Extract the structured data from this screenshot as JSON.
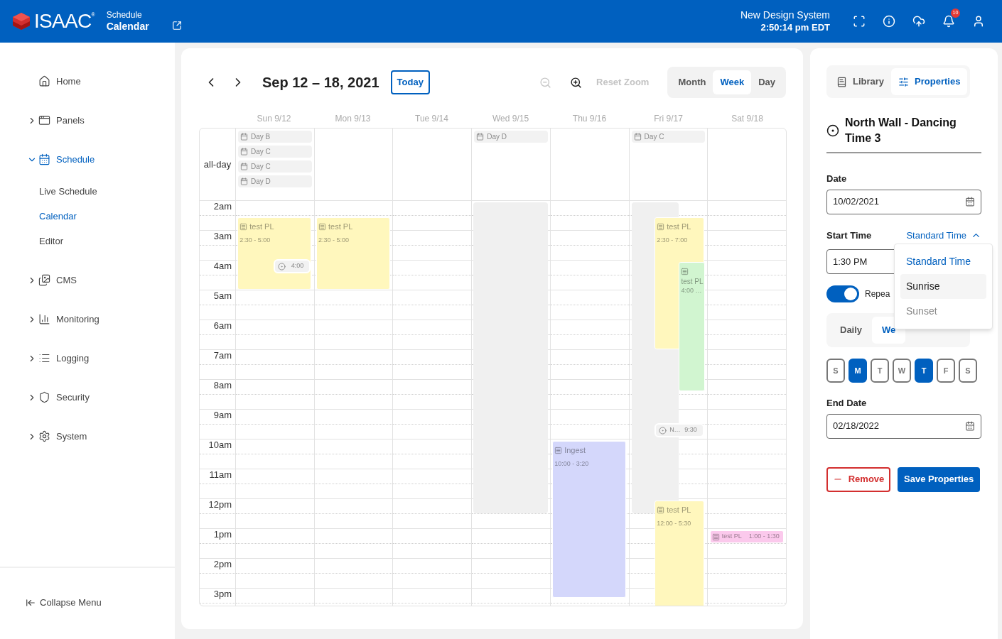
{
  "header": {
    "brand": "ISAAC",
    "brand_mark": "®",
    "section": "Schedule",
    "page": "Calendar",
    "system": "New Design System",
    "clock": "2:50:14 pm EDT",
    "notifications": "10"
  },
  "sidebar": {
    "items": [
      {
        "label": "Home",
        "selected": false
      },
      {
        "label": "Panels",
        "expanded": false,
        "selected": false
      },
      {
        "label": "Schedule",
        "expanded": true,
        "selected": true,
        "children": [
          {
            "label": "Live Schedule",
            "selected": false
          },
          {
            "label": "Calendar",
            "selected": true
          },
          {
            "label": "Editor",
            "selected": false
          }
        ]
      },
      {
        "label": "CMS",
        "expanded": false,
        "selected": false
      },
      {
        "label": "Monitoring",
        "expanded": false,
        "selected": false
      },
      {
        "label": "Logging",
        "expanded": false,
        "selected": false
      },
      {
        "label": "Security",
        "expanded": false,
        "selected": false
      },
      {
        "label": "System",
        "expanded": false,
        "selected": false
      }
    ],
    "collapse": "Collapse Menu"
  },
  "toolbar": {
    "range": "Sep 12 – 18, 2021",
    "today": "Today",
    "zoom_out_disabled": true,
    "reset_zoom": "Reset Zoom",
    "reset_disabled": true,
    "views": [
      {
        "label": "Month",
        "selected": false
      },
      {
        "label": "Week",
        "selected": true
      },
      {
        "label": "Day",
        "selected": false
      }
    ]
  },
  "calendar": {
    "all_day_label": "all-day",
    "hours": [
      "2am",
      "3am",
      "4am",
      "5am",
      "6am",
      "7am",
      "8am",
      "9am",
      "10am",
      "11am",
      "12pm",
      "1pm",
      "2pm",
      "3pm"
    ],
    "days": [
      {
        "label": "Sun 9/12",
        "all_day": [
          "Day B",
          "Day C",
          "Day C",
          "Day D"
        ],
        "events": [
          {
            "kind": "playlist",
            "title": "test PL",
            "time": "2:30 - 5:00",
            "color": "#fff7bd"
          },
          {
            "kind": "marker",
            "time": "4:00"
          }
        ]
      },
      {
        "label": "Mon 9/13",
        "events": [
          {
            "kind": "playlist",
            "title": "test PL",
            "time": "2:30 - 5:00",
            "color": "#fff7bd"
          }
        ]
      },
      {
        "label": "Tue 9/14"
      },
      {
        "label": "Wed 9/15",
        "all_day": [
          "Day D"
        ],
        "events": [
          {
            "kind": "blocked"
          }
        ]
      },
      {
        "label": "Thu 9/16",
        "events": [
          {
            "kind": "playlist",
            "title": "Ingest",
            "time": "10:00 - 3:20",
            "color": "#d4d7fb"
          }
        ]
      },
      {
        "label": "Fri 9/17",
        "all_day": [
          "Day C"
        ],
        "events": [
          {
            "kind": "blocked"
          },
          {
            "kind": "playlist",
            "title": "test PL",
            "time": "2:30 - 7:00",
            "color": "#fff7bd"
          },
          {
            "kind": "playlist",
            "title": "test PL",
            "time": "4:00 …",
            "color": "#d1f5d0"
          },
          {
            "kind": "marker",
            "name": "N…",
            "time": "9:30"
          },
          {
            "kind": "playlist",
            "title": "test PL",
            "time": "12:00 - 5:30",
            "color": "#fff7bd"
          }
        ]
      },
      {
        "label": "Sat 9/18",
        "events": [
          {
            "kind": "playlist",
            "title": "test PL",
            "time": "1:00 - 1:30",
            "color": "#fbc9ec"
          }
        ]
      }
    ]
  },
  "panel": {
    "tabs": [
      {
        "label": "Library",
        "selected": false
      },
      {
        "label": "Properties",
        "selected": true
      }
    ],
    "title": "North Wall - Dancing Time 3",
    "date_label": "Date",
    "date": "10/02/2021",
    "start_label": "Start Time",
    "time_mode": "Standard Time",
    "time_menu_open": true,
    "start_time": "1:30 PM",
    "repeat_on": true,
    "repeat_label": "Repea",
    "repeat_modes": [
      {
        "label": "Daily",
        "selected": false
      },
      {
        "label": "We",
        "selected": true
      }
    ],
    "weekdays": [
      {
        "label": "S",
        "selected": false
      },
      {
        "label": "M",
        "selected": true
      },
      {
        "label": "T",
        "selected": false
      },
      {
        "label": "W",
        "selected": false
      },
      {
        "label": "T",
        "selected": true
      },
      {
        "label": "F",
        "selected": false
      },
      {
        "label": "S",
        "selected": false
      }
    ],
    "end_label": "End Date",
    "end_date": "02/18/2022",
    "remove": "Remove",
    "save": "Save Properties",
    "time_options": [
      {
        "label": "Standard Time",
        "selected": true,
        "highlighted": false
      },
      {
        "label": "Sunrise",
        "selected": false,
        "highlighted": true
      },
      {
        "label": "Sunset",
        "selected": false,
        "highlighted": false
      }
    ]
  }
}
